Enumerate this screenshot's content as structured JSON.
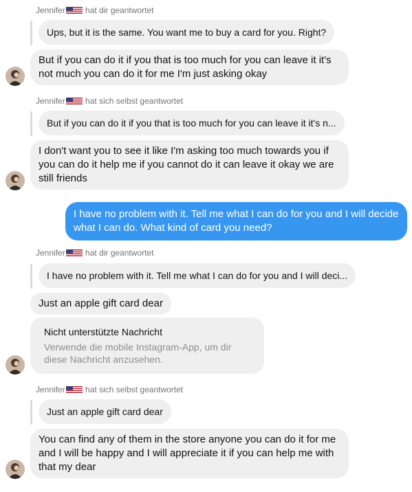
{
  "thread": {
    "reply1": {
      "sender": "Jennifer",
      "flag": "us-flag-icon",
      "suffix": "hat dir geantwortet"
    },
    "quote1": "Ups, but it is the same. You want me to buy a card for you. Right?",
    "msg1": "But if you can do it if you that is too much for you can leave it it's not much you can do it for me I'm just asking okay",
    "reply2": {
      "sender": "Jennifer",
      "flag": "us-flag-icon",
      "suffix": "hat sich selbst geantwortet"
    },
    "quote2": "But if you can do it if you that is too much for you can leave it it's n...",
    "msg2": "I don't want you to see it like I'm asking too much towards you if you can do it help me if you cannot do it can leave it okay we are still friends",
    "my_msg": "I have no problem with it. Tell me what I can do for you and I will decide what I can do. What kind of card you need?",
    "reply3": {
      "sender": "Jennifer",
      "flag": "us-flag-icon",
      "suffix": "hat dir geantwortet"
    },
    "quote3": "I have no problem with it. Tell me what I can do for you and I will deci...",
    "msg3": "Just an apple gift card dear",
    "unsupported": {
      "title": "Nicht unterstützte Nachricht",
      "desc": "Verwende die mobile Instagram-App, um dir diese Nachricht anzusehen."
    },
    "reply4": {
      "sender": "Jennifer",
      "flag": "us-flag-icon",
      "suffix": "hat sich selbst geantwortet"
    },
    "quote4": "Just an apple gift card dear",
    "msg4": "You can find any of them in the store anyone you can do it for me and I will be happy and I will appreciate it if you can help me with that my dear"
  },
  "colors": {
    "incoming_bubble": "#efefef",
    "outgoing_bubble": "#3797f0",
    "meta_text": "#737373"
  }
}
